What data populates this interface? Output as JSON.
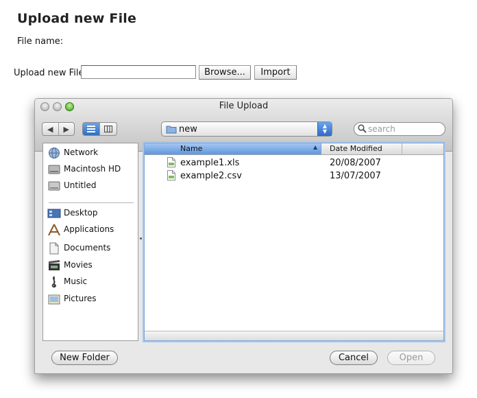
{
  "page": {
    "title": "Upload new File",
    "file_name_label": "File name:",
    "upload_label": "Upload new File",
    "file_path_value": "",
    "browse_label": "Browse...",
    "import_label": "Import"
  },
  "dialog": {
    "title": "File Upload",
    "location": "new",
    "search_placeholder": "search",
    "sidebar": {
      "devices": [
        {
          "label": "Network",
          "icon": "globe-icon"
        },
        {
          "label": "Macintosh HD",
          "icon": "hard-drive-icon"
        },
        {
          "label": "Untitled",
          "icon": "disk-icon"
        }
      ],
      "places": [
        {
          "label": "Desktop",
          "icon": "desktop-icon"
        },
        {
          "label": "Applications",
          "icon": "applications-icon"
        },
        {
          "label": "Documents",
          "icon": "documents-icon"
        },
        {
          "label": "Movies",
          "icon": "movies-icon"
        },
        {
          "label": "Music",
          "icon": "music-icon"
        },
        {
          "label": "Pictures",
          "icon": "pictures-icon"
        }
      ]
    },
    "columns": {
      "name": "Name",
      "date": "Date Modified"
    },
    "files": [
      {
        "name": "example1.xls",
        "date": "20/08/2007"
      },
      {
        "name": "example2.csv",
        "date": "13/07/2007"
      }
    ],
    "buttons": {
      "new_folder": "New Folder",
      "cancel": "Cancel",
      "open": "Open"
    }
  }
}
